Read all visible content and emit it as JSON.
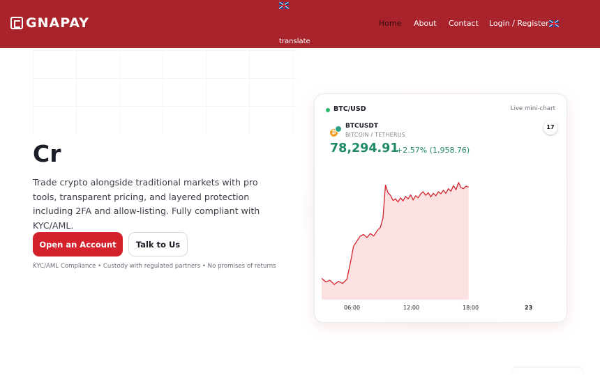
{
  "header": {
    "brand": "GNAPAY",
    "translate_label": "translate",
    "nav": {
      "home": "Home",
      "about": "About",
      "contact": "Contact",
      "login": "Login / Register"
    },
    "flag_icon": "uk-flag-icon",
    "bar_color": "#a8232b"
  },
  "hero": {
    "title": "Cr",
    "description": "Trade crypto alongside traditional markets with pro tools, transparent pricing, and layered protection including 2FA and allow-listing. Fully compliant with KYC/AML.",
    "primary_button": "Open an Account",
    "secondary_button": "Talk to Us",
    "note": "KYC/AML Compliance • Custody with regulated partners • No promises of returns",
    "accent_color": "#d3222b"
  },
  "chart_card": {
    "pair": "BTC/USD",
    "mode": "Live mini-chart",
    "symbol": "BTCUSDT",
    "symbol_sub": "BITCOIN / TETHERUS",
    "tv_badge": "17",
    "coin_glyph": "₿",
    "price": "78,294.91",
    "change": "+2.57% (1,958.76)",
    "up_color": "#1f8a66"
  },
  "chart_data": {
    "type": "area",
    "title": "",
    "xlabel": "",
    "ylabel": "",
    "x_ticks": [
      "06:00",
      "12:00",
      "18:00",
      "23"
    ],
    "ylim": [
      76000,
      78600
    ],
    "line_color": "#d3222b",
    "fill_color": "#fbe2e2",
    "series": [
      {
        "name": "",
        "x_hours": [
          0,
          0.5,
          1,
          1.5,
          2,
          2.5,
          3,
          3.4,
          3.8,
          4.2,
          4.6,
          5,
          5.4,
          5.8,
          6.2,
          6.6,
          7,
          7.3,
          7.6,
          7.9,
          8.2,
          8.5,
          8.8,
          9.1,
          9.4,
          9.7,
          10,
          10.3,
          10.6,
          10.9,
          11.2,
          11.5,
          11.8,
          12.1,
          12.4,
          12.7,
          13,
          13.3,
          13.6,
          13.9,
          14.2,
          14.5,
          14.8,
          15.1,
          15.4,
          15.7,
          16,
          16.3,
          16.6,
          16.9,
          17.2,
          17.5
        ],
        "values": [
          76420,
          76350,
          76380,
          76300,
          76360,
          76320,
          76400,
          76700,
          77050,
          77150,
          77250,
          77280,
          77220,
          77300,
          77250,
          77350,
          77420,
          77600,
          78250,
          78100,
          78050,
          77950,
          77980,
          77920,
          78000,
          77940,
          78030,
          77980,
          78060,
          77960,
          78040,
          78000,
          78080,
          78120,
          78050,
          78100,
          78020,
          78090,
          78040,
          78120,
          78080,
          78150,
          78090,
          78180,
          78130,
          78240,
          78160,
          78300,
          78200,
          78180,
          78230,
          78210
        ]
      }
    ]
  }
}
